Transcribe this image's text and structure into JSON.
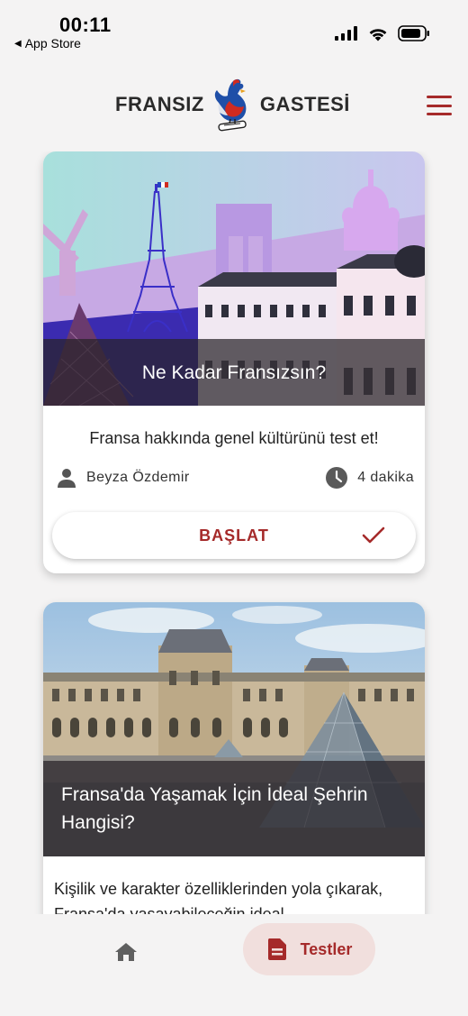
{
  "status_bar": {
    "time": "00:11",
    "back_app": "App Store"
  },
  "header": {
    "logo_left": "FRANSIZ",
    "logo_right": "GASTESİ",
    "menu_icon": "hamburger-menu-icon"
  },
  "cards": [
    {
      "title": "Ne Kadar Fransızsın?",
      "description": "Fransa hakkında genel kültürünü test et!",
      "author": "Beyza Özdemir",
      "duration": "4 dakika",
      "button_label": "BAŞLAT",
      "completed": true
    },
    {
      "title": "Fransa'da Yaşamak İçin İdeal Şehrin Hangisi?",
      "description": "Kişilik ve karakter özelliklerinden yola çıkarak, Fransa'da yaşayabileceğin ideal"
    }
  ],
  "bottom_nav": {
    "home_icon": "home-icon",
    "tests_label": "Testler",
    "tests_icon": "document-icon"
  },
  "colors": {
    "accent": "#a52a2a",
    "background": "#f4f3f3",
    "active_tab_bg": "#f1dfdd"
  }
}
